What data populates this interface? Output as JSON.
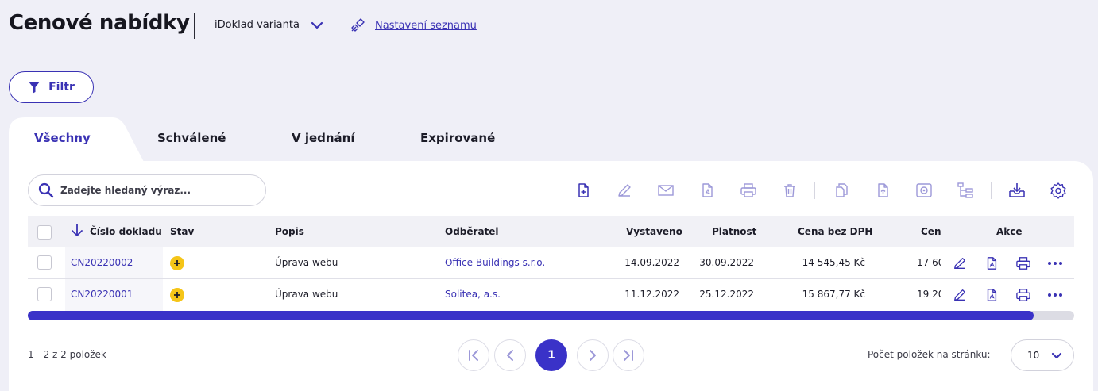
{
  "header": {
    "title": "Cenové nabídky",
    "variant": "iDoklad varianta",
    "list_settings": "Nastavení seznamu"
  },
  "filter": {
    "label": "Filtr"
  },
  "tabs": [
    {
      "label": "Všechny",
      "active": true
    },
    {
      "label": "Schválené",
      "active": false
    },
    {
      "label": "V jednání",
      "active": false
    },
    {
      "label": "Expirované",
      "active": false
    }
  ],
  "search": {
    "placeholder": "Zadejte hledaný výraz..."
  },
  "toolbar": {
    "icons": [
      "new-document-icon",
      "edit-icon",
      "email-icon",
      "pdf-icon",
      "print-icon",
      "delete-icon",
      "copy-icon",
      "export-icon",
      "safe-icon",
      "hierarchy-icon",
      "download-icon",
      "settings-icon"
    ]
  },
  "table": {
    "columns": {
      "number": "Číslo dokladu",
      "status": "Stav",
      "description": "Popis",
      "customer": "Odběratel",
      "issued": "Vystaveno",
      "valid_until": "Platnost",
      "price_no_vat": "Cena bez DPH",
      "price": "Cena",
      "actions": "Akce"
    },
    "rows": [
      {
        "number": "CN20220002",
        "description": "Úprava webu",
        "customer": "Office Buildings s.r.o.",
        "issued": "14.09.2022",
        "valid_until": "30.09.2022",
        "price_no_vat": "14 545,45 Kč",
        "price": "17 60"
      },
      {
        "number": "CN20220001",
        "description": "Úprava webu",
        "customer": "Solitea, a.s.",
        "issued": "11.12.2022",
        "valid_until": "25.12.2022",
        "price_no_vat": "15 867,77 Kč",
        "price": "19 20"
      }
    ]
  },
  "pagination": {
    "summary": "1 - 2 z 2 položek",
    "current_page": "1",
    "per_page_label": "Počet položek na stránku:",
    "per_page_value": "10"
  },
  "colors": {
    "accent": "#3a32c8",
    "background": "#efeff7",
    "status_badge": "#f5c518"
  }
}
